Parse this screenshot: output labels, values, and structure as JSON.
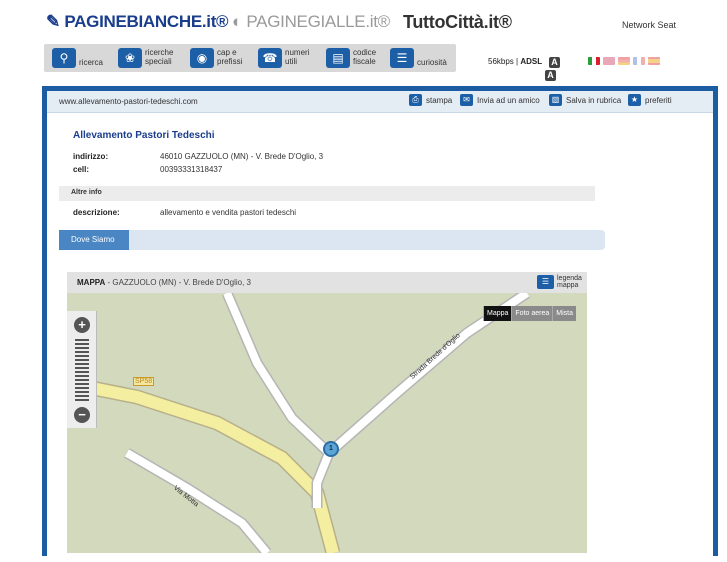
{
  "header": {
    "logo_pagine_bianche": "PAGINEBIANCHE.it®",
    "logo_pagine_gialle": "PAGINEGIALLE.it®",
    "logo_tutto_citta": "TuttoCittà.it®",
    "network": "Network Seat"
  },
  "toolbar": {
    "items": [
      {
        "label": "ricerca",
        "icon": "search-icon"
      },
      {
        "label": "ricerche\nspeciali",
        "icon": "puzzle-icon"
      },
      {
        "label": "cap e\nprefissi",
        "icon": "globe-icon"
      },
      {
        "label": "numeri\nutili",
        "icon": "phone-icon"
      },
      {
        "label": "codice\nfiscale",
        "icon": "card-icon"
      },
      {
        "label": "curiosità",
        "icon": "book-icon"
      }
    ]
  },
  "connection": {
    "speed": "56kbps",
    "adsl": "ADSL",
    "text_size_a": "A",
    "text_size_a2": "A"
  },
  "languages": [
    "it",
    "en",
    "es",
    "fr",
    "de"
  ],
  "colors": {
    "brand_blue": "#1b5ca3",
    "tab_blue": "#4a86c4",
    "map_bg": "#d2d9bc",
    "road_yellow": "#f3eea0"
  },
  "urlbar": {
    "url": "www.allevamento-pastori-tedeschi.com",
    "actions": {
      "print": "stampa",
      "send": "Invia ad un amico",
      "save": "Salva in rubrica",
      "favorites": "preferiti"
    }
  },
  "listing": {
    "title": "Allevamento Pastori Tedeschi",
    "address_label": "indirizzo:",
    "address_value": "46010 GAZZUOLO (MN) - V. Brede D'Oglio, 3",
    "cell_label": "cell:",
    "cell_value": "00393331318437",
    "section_more": "Altre info",
    "description_label": "descrizione:",
    "description_value": "allevamento e vendita pastori tedeschi"
  },
  "tabs": {
    "where": "Dove Siamo"
  },
  "map": {
    "header_bold": "MAPPA",
    "header_rest": " - GAZZUOLO (MN) - V. Brede D'Oglio, 3",
    "legend_line1": "legenda",
    "legend_line2": "mappa",
    "modes": [
      "Mappa",
      "Foto aerea",
      "Mista"
    ],
    "selected_mode": "Mappa",
    "road_label_sp": "SP58",
    "road_label_strada": "Strada Brede d'Oglio",
    "road_label_via": "Via Motta",
    "marker": "1"
  }
}
